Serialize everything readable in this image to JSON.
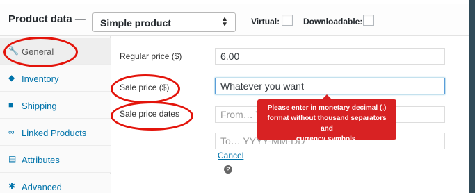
{
  "header": {
    "title": "Product data —",
    "product_type": "Simple product",
    "virtual_label": "Virtual:",
    "downloadable_label": "Downloadable:"
  },
  "sidebar": {
    "items": [
      {
        "label": "General",
        "icon": "wrench-icon",
        "active": true
      },
      {
        "label": "Inventory",
        "icon": "tag-icon",
        "active": false
      },
      {
        "label": "Shipping",
        "icon": "truck-icon",
        "active": false
      },
      {
        "label": "Linked Products",
        "icon": "link-icon",
        "active": false
      },
      {
        "label": "Attributes",
        "icon": "list-icon",
        "active": false
      },
      {
        "label": "Advanced",
        "icon": "gear-icon",
        "active": false
      }
    ]
  },
  "fields": {
    "regular_price": {
      "label": "Regular price ($)",
      "value": "6.00"
    },
    "sale_price": {
      "label": "Sale price ($)",
      "value": "Whatever you want"
    },
    "sale_price_dates": {
      "label": "Sale price dates",
      "from_placeholder": "From… Y",
      "to_placeholder": "To…  YYYY-MM-DD"
    },
    "cancel_link": "Cancel",
    "help_glyph": "?"
  },
  "tooltip": {
    "line1": "Please enter in monetary decimal (.)",
    "line2": "format without thousand separators and",
    "line3": "currency symbols."
  },
  "colors": {
    "accent": "#0073aa",
    "error": "#d82223",
    "annotation": "#e3140b",
    "frame": "#2f4a58"
  }
}
